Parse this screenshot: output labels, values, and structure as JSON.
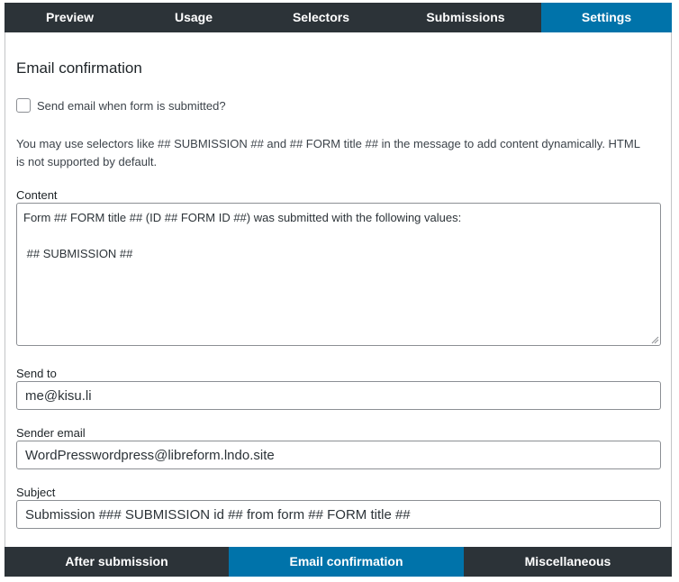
{
  "top_tabs": [
    {
      "label": "Preview",
      "active": false
    },
    {
      "label": "Usage",
      "active": false
    },
    {
      "label": "Selectors",
      "active": false
    },
    {
      "label": "Submissions",
      "active": false
    },
    {
      "label": "Settings",
      "active": true
    }
  ],
  "section": {
    "title": "Email confirmation"
  },
  "send_email": {
    "label": "Send email when form is submitted?",
    "checked": false
  },
  "help_text": "You may use selectors like ## SUBMISSION ## and ## FORM title ## in the message to add content dynamically. HTML is not supported by default.",
  "content": {
    "label": "Content",
    "value": "Form ## FORM title ## (ID ## FORM ID ##) was submitted with the following values:\n\n ## SUBMISSION ##"
  },
  "send_to": {
    "label": "Send to",
    "value": "me@kisu.li"
  },
  "sender_email": {
    "label": "Sender email",
    "value": "WordPresswordpress@libreform.lndo.site"
  },
  "subject": {
    "label": "Subject",
    "value": "Submission ### SUBMISSION id ## from form ## FORM title ##"
  },
  "bottom_tabs": [
    {
      "label": "After submission",
      "active": false
    },
    {
      "label": "Email confirmation",
      "active": true
    },
    {
      "label": "Miscellaneous",
      "active": false
    }
  ],
  "colors": {
    "tab_bar": "#2c3338",
    "tab_active": "#0073aa",
    "tab_text": "#ffffff",
    "border": "#8c8f94"
  }
}
